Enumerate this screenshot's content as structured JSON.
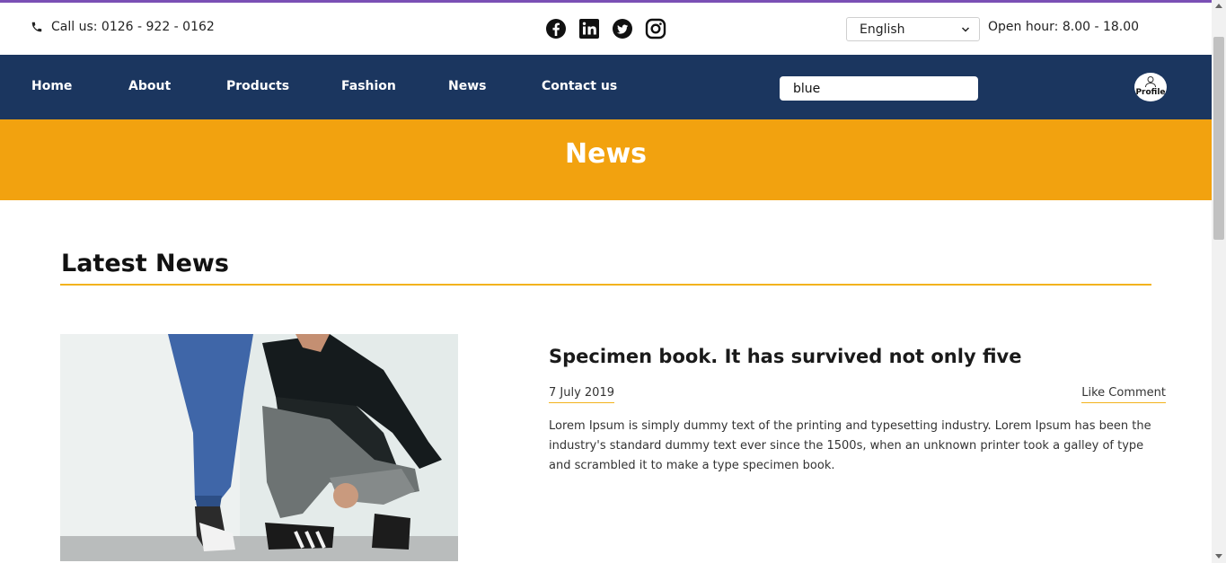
{
  "colors": {
    "accent_bar": "#7a4fb5",
    "nav_bg": "#1b365f",
    "banner_bg": "#f2a20f",
    "rule": "#f2b31d"
  },
  "topbar": {
    "call_label": "Call us: 0126 - 922 - 0162",
    "social_icons": [
      "facebook-icon",
      "linkedin-icon",
      "twitter-icon",
      "instagram-icon"
    ],
    "language_selected": "English",
    "open_hours": "Open hour: 8.00 - 18.00"
  },
  "nav": {
    "items": [
      {
        "label": "Home"
      },
      {
        "label": "About"
      },
      {
        "label": "Products"
      },
      {
        "label": "Fashion"
      },
      {
        "label": "News"
      },
      {
        "label": "Contact us"
      }
    ],
    "search_value": "blue",
    "profile_label": "Profile"
  },
  "banner": {
    "title": "News"
  },
  "main": {
    "section_title": "Latest News",
    "article": {
      "title": "Specimen book. It has survived not only five",
      "date": "7 July 2019",
      "comment_link": "Like Comment",
      "body": "Lorem Ipsum is simply dummy text of the printing and typesetting industry. Lorem Ipsum has been the industry's standard dummy text ever since the 1500s, when an unknown printer took a galley of type and scrambled it to make a type specimen book."
    }
  }
}
